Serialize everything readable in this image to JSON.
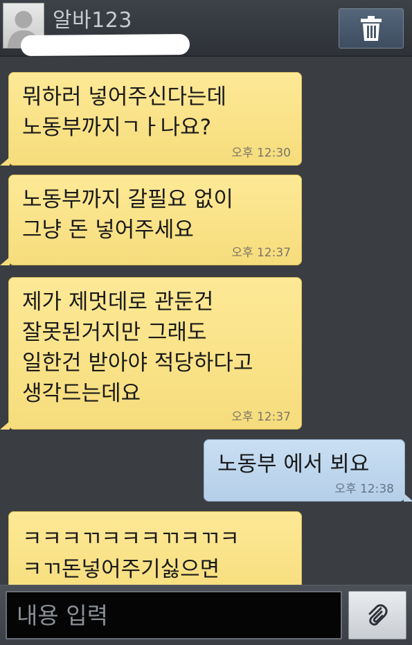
{
  "header": {
    "contact_name": "알바123",
    "delete_icon": "trash-icon",
    "avatar_icon": "person-silhouette-icon"
  },
  "messages": [
    {
      "direction": "in",
      "text": "뭐하러 넣어주신다는데\n노동부까지ㄱㅏ나요?",
      "time": "오후 12:30"
    },
    {
      "direction": "in",
      "text": "노동부까지 갈필요 없이\n그냥 돈 넣어주세요",
      "time": "오후 12:37"
    },
    {
      "direction": "in",
      "text": "제가 제멋데로 관둔건\n잘못된거지만 그래도\n일한건 받아야 적당하다고\n생각드는데요",
      "time": "오후 12:37"
    },
    {
      "direction": "out",
      "text": "노동부 에서 뵈요",
      "time": "오후 12:38"
    },
    {
      "direction": "in",
      "text": "ㅋㅋㅋㄲㅋㅋㅋㄲㅋㄲㅋ\nㅋㄲ돈넣어주기싫으면",
      "time": ""
    }
  ],
  "composer": {
    "placeholder": "내용 입력",
    "attach_icon": "paperclip-icon"
  },
  "colors": {
    "incoming_bubble": "#fbe38a",
    "outgoing_bubble": "#c1d8ee",
    "background": "#3a3d42"
  }
}
